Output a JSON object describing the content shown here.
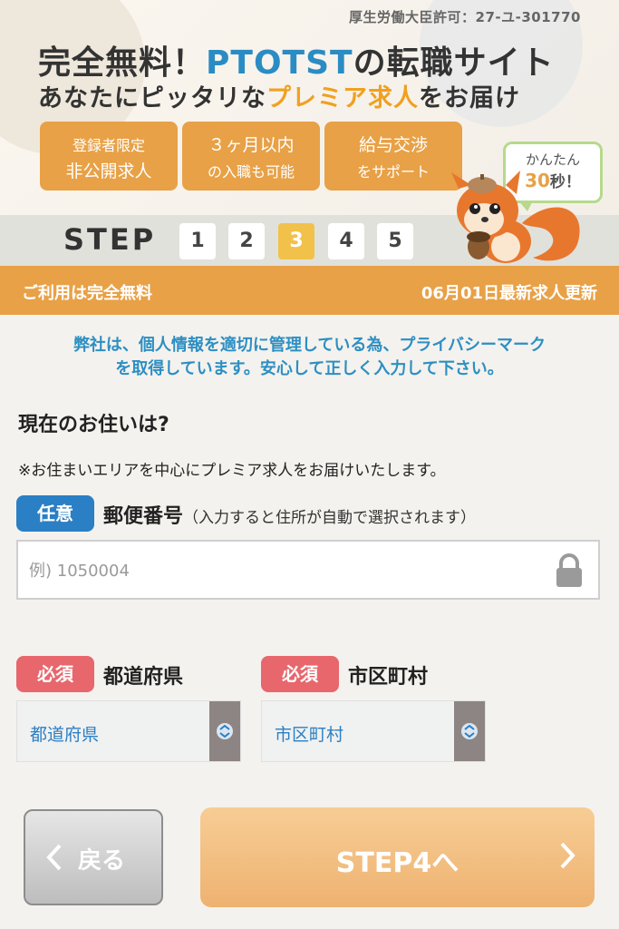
{
  "header": {
    "license": "厚生労働大臣許可：27-ユ-301770",
    "headline1_a": "完全無料！",
    "headline1_brand": "PTOTST",
    "headline1_b": "の転職サイト",
    "headline2_a": "あなたにピッタリな",
    "headline2_premium": "プレミア求人",
    "headline2_b": "をお届け",
    "features": [
      {
        "line1": "登録者限定",
        "line2": "非公開求人"
      },
      {
        "line1": "３ヶ月以内",
        "line2": "の入職も可能"
      },
      {
        "line1": "給与交渉",
        "line2": "をサポート"
      }
    ],
    "speech": {
      "line1": "かんたん",
      "num": "30",
      "unit": "秒！"
    }
  },
  "steps": {
    "label": "STEP",
    "items": [
      "1",
      "2",
      "3",
      "4",
      "5"
    ],
    "active_index": 2
  },
  "strip": {
    "left": "ご利用は完全無料",
    "right": "06月01日最新求人更新"
  },
  "privacy": {
    "line1": "弊社は、個人情報を適切に管理している為、プライバシーマーク",
    "line2": "を取得しています。安心して正しく入力して下さい。"
  },
  "question": {
    "title": "現在のお住いは?",
    "note": "※お住まいエリアを中心にプレミア求人をお届けいたします。"
  },
  "zip": {
    "tag": "任意",
    "label": "郵便番号",
    "hint": "（入力すると住所が自動で選択されます）",
    "placeholder": "例) 1050004",
    "value": ""
  },
  "prefecture": {
    "tag": "必須",
    "label": "都道府県",
    "selected": "都道府県"
  },
  "city": {
    "tag": "必須",
    "label": "市区町村",
    "selected": "市区町村"
  },
  "buttons": {
    "back": "戻る",
    "next": "STEP4へ"
  },
  "colors": {
    "accent": "#e8a146",
    "blue": "#2b7fc4",
    "required": "#e7676d",
    "step_active": "#f2c14a"
  }
}
